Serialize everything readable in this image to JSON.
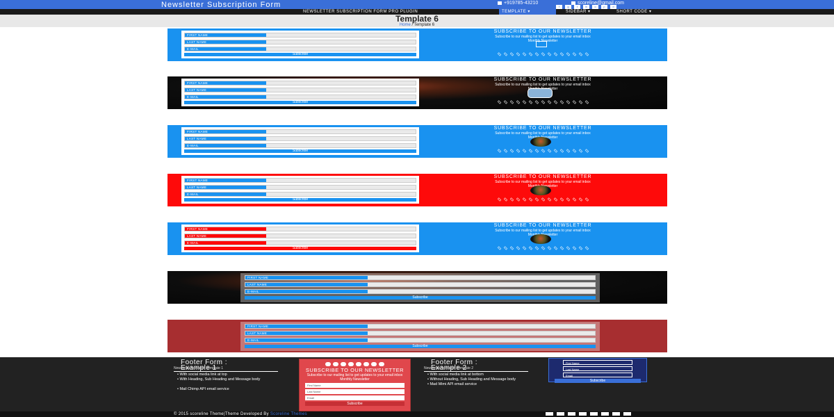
{
  "header": {
    "site_title": "Newsletter Subscription Form",
    "phone": "+919785-43210",
    "email": "scoreline@gmail.com",
    "social_icons": [
      "facebook-icon",
      "google-plus-icon",
      "twitter-icon",
      "linkedin-icon",
      "instagram-icon",
      "pinterest-icon",
      "dribbble-icon"
    ]
  },
  "nav": {
    "items": [
      {
        "label": "NEWSLETTER SUBSCRIPTION FORM PRO PLUGIN",
        "active": false
      },
      {
        "label": "TEMPLATE ▾",
        "active": true
      },
      {
        "label": "SIDEBAR ▾",
        "active": false
      },
      {
        "label": "SHORT CODE ▾",
        "active": false
      }
    ]
  },
  "page": {
    "title": "Template 6",
    "breadcrumb_home": "Home",
    "breadcrumb_sep": "/",
    "breadcrumb_current": "Template 6"
  },
  "form": {
    "first_name_label": "FIRST NAME",
    "last_name_label": "LAST NAME",
    "email_label": "E-MAIL",
    "subscribe_label": "Subscribe"
  },
  "side": {
    "heading": "SUBSCRIBE TO OUR NEWSLETTER",
    "text": "Subscribe to our mailing list to get updates to your email inbox",
    "monthly": "Monthly Newsletter"
  },
  "colors": {
    "blue": "#1992f0",
    "red": "#fe0a0a",
    "darkred": "#a72e30",
    "navy": "#3a6fd8",
    "dark": "#222222"
  },
  "footer": {
    "col1_title": "Footer Form :",
    "col1_title2": "Example 1",
    "col1_sub": "Newsletter form with Template 1",
    "col1_items": [
      "With social media link at top",
      "With Heading, Sub Heading and Message body",
      "Mail Chimp API email service"
    ],
    "red_widget_heading": "SUBSCRIBE TO OUR NEWSLETTER",
    "red_widget_text": "Subscribe to our mailing list to get updates to your email inbox",
    "red_widget_monthly": "Monthly Newsletter",
    "red_first": "First Name",
    "red_last": "Last Name",
    "red_email": "Email",
    "red_subscribe": "Subscribe",
    "col3_title": "Footer Form :",
    "col3_title2": "Example 2",
    "col3_sub": "Newsletter form with Template 2",
    "col3_items": [
      "With social media link at bottom",
      "Without Heading, Sub Heading and Message body",
      "Mad Mimi API email service"
    ],
    "blue_first": "First Name",
    "blue_last": "Last Name",
    "blue_email": "Email",
    "blue_subscribe": "Subscribe",
    "copyright": "© 2015 scoreline Theme|Theme Developed By",
    "copyright_brand": "Scoreline Themes"
  }
}
